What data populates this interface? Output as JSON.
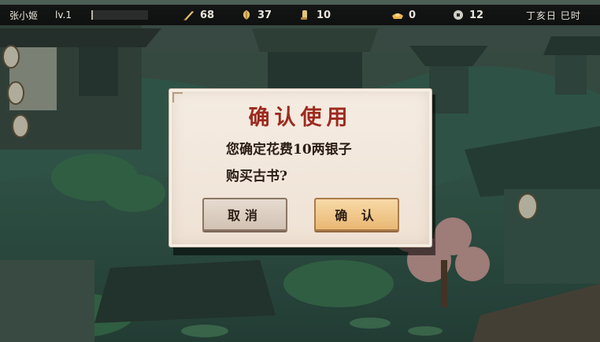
{
  "topbar": {
    "player_name": "张小姬",
    "level": "lv.1",
    "stats": [
      {
        "icon": "brush-icon",
        "value": "68"
      },
      {
        "icon": "leaf-icon",
        "value": "37"
      },
      {
        "icon": "scroll-icon",
        "value": "10"
      },
      {
        "icon": "silver-ingot-icon",
        "value": "0"
      },
      {
        "icon": "coin-icon",
        "value": "12"
      }
    ],
    "date": "丁亥日 巳时"
  },
  "dialog": {
    "title": "确认使用",
    "message_line1": "您确定花费10两银子",
    "message_line2": "购买古书?",
    "cancel_label": "取消",
    "confirm_label": "确 认"
  },
  "colors": {
    "title_red": "#9d2a1e",
    "confirm_gold": "#e9b873",
    "panel_paper": "#f2e7dc"
  }
}
